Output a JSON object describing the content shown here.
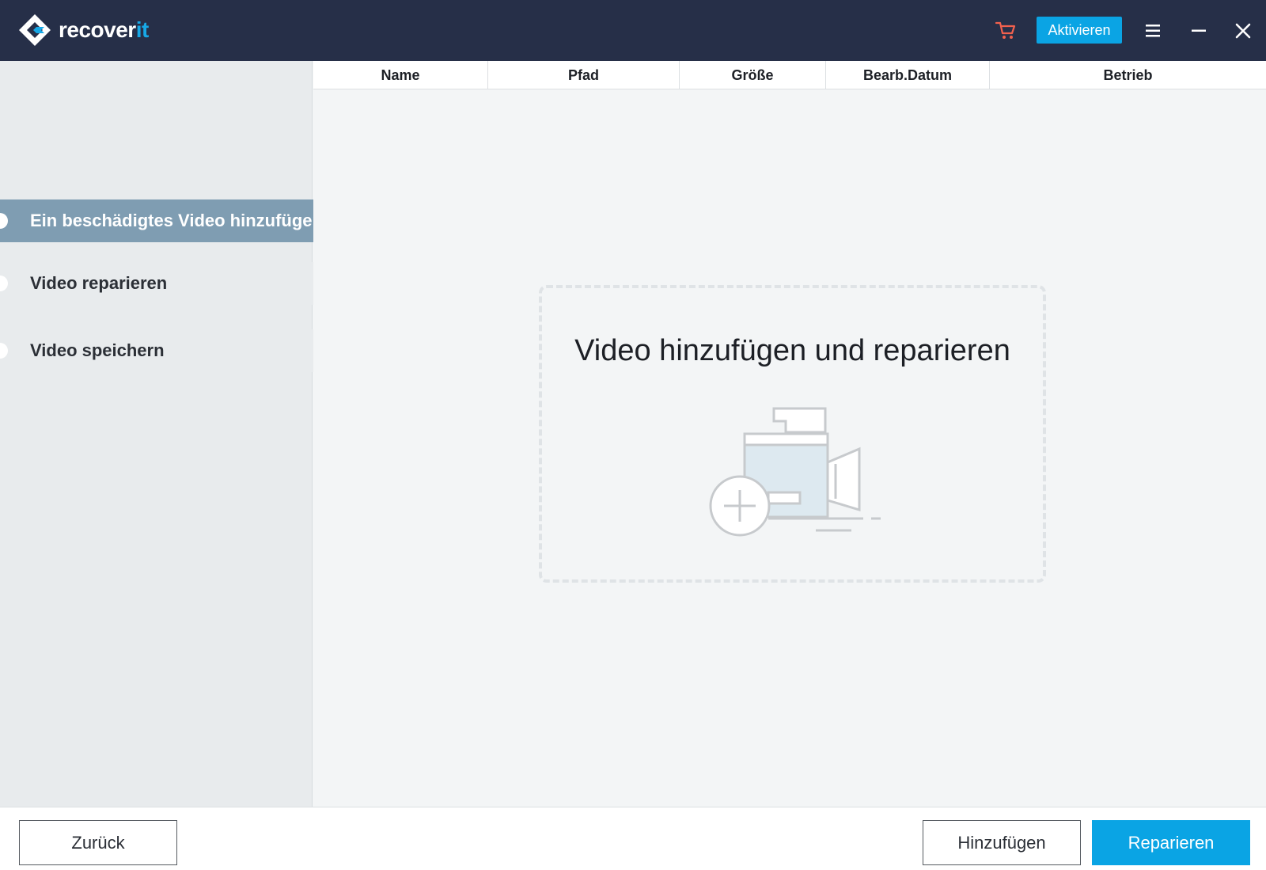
{
  "app": {
    "logo_text_main": "recover",
    "logo_text_accent": "it",
    "brand_color": "#17a8e6",
    "titlebar_color": "#262f48"
  },
  "titlebar": {
    "activate_label": "Aktivieren",
    "icons": [
      "cart-icon",
      "menu-icon",
      "minimize-icon",
      "close-icon"
    ]
  },
  "sidebar": {
    "steps": [
      {
        "label": "Ein beschädigtes Video hinzufügen",
        "state": "active"
      },
      {
        "label": "Video reparieren",
        "state": "inactive"
      },
      {
        "label": "Video speichern",
        "state": "inactive"
      }
    ],
    "active_color": "#7f9db2"
  },
  "table": {
    "columns": [
      "Name",
      "Pfad",
      "Größe",
      "Bearb.Datum",
      "Betrieb"
    ]
  },
  "dropzone": {
    "title": "Video hinzufügen und reparieren",
    "icon": "video-camera-add-icon"
  },
  "footer": {
    "back_label": "Zurück",
    "add_label": "Hinzufügen",
    "repair_label": "Reparieren",
    "primary_color": "#0aa4e4"
  }
}
